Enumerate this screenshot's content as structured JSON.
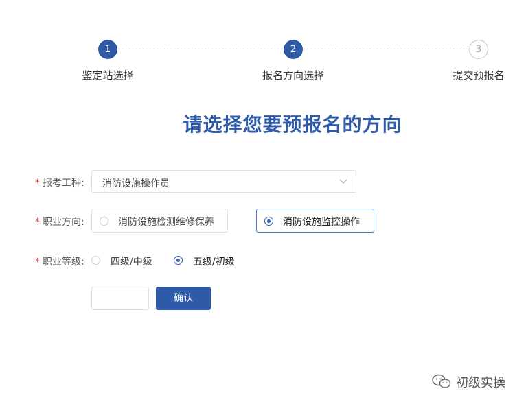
{
  "stepper": {
    "steps": [
      {
        "number": "1",
        "label": "鉴定站选择",
        "state": "done"
      },
      {
        "number": "2",
        "label": "报名方向选择",
        "state": "active"
      },
      {
        "number": "3",
        "label": "提交预报名",
        "state": "pending"
      }
    ]
  },
  "heading": "请选择您要预报名的方向",
  "form": {
    "exam_type": {
      "label": "报考工种:",
      "value": "消防设施操作员"
    },
    "direction": {
      "label": "职业方向:",
      "options": [
        "消防设施检测维修保养",
        "消防设施监控操作"
      ],
      "selected": "消防设施监控操作"
    },
    "level": {
      "label": "职业等级:",
      "options": [
        "四级/中级",
        "五级/初级"
      ],
      "selected": "五级/初级"
    },
    "required_mark": "*",
    "confirm_label": "确认"
  },
  "watermark": {
    "text": "初级实操",
    "icon": "wechat-icon"
  },
  "colors": {
    "accent": "#2e5aa8",
    "required": "#e0453a"
  }
}
